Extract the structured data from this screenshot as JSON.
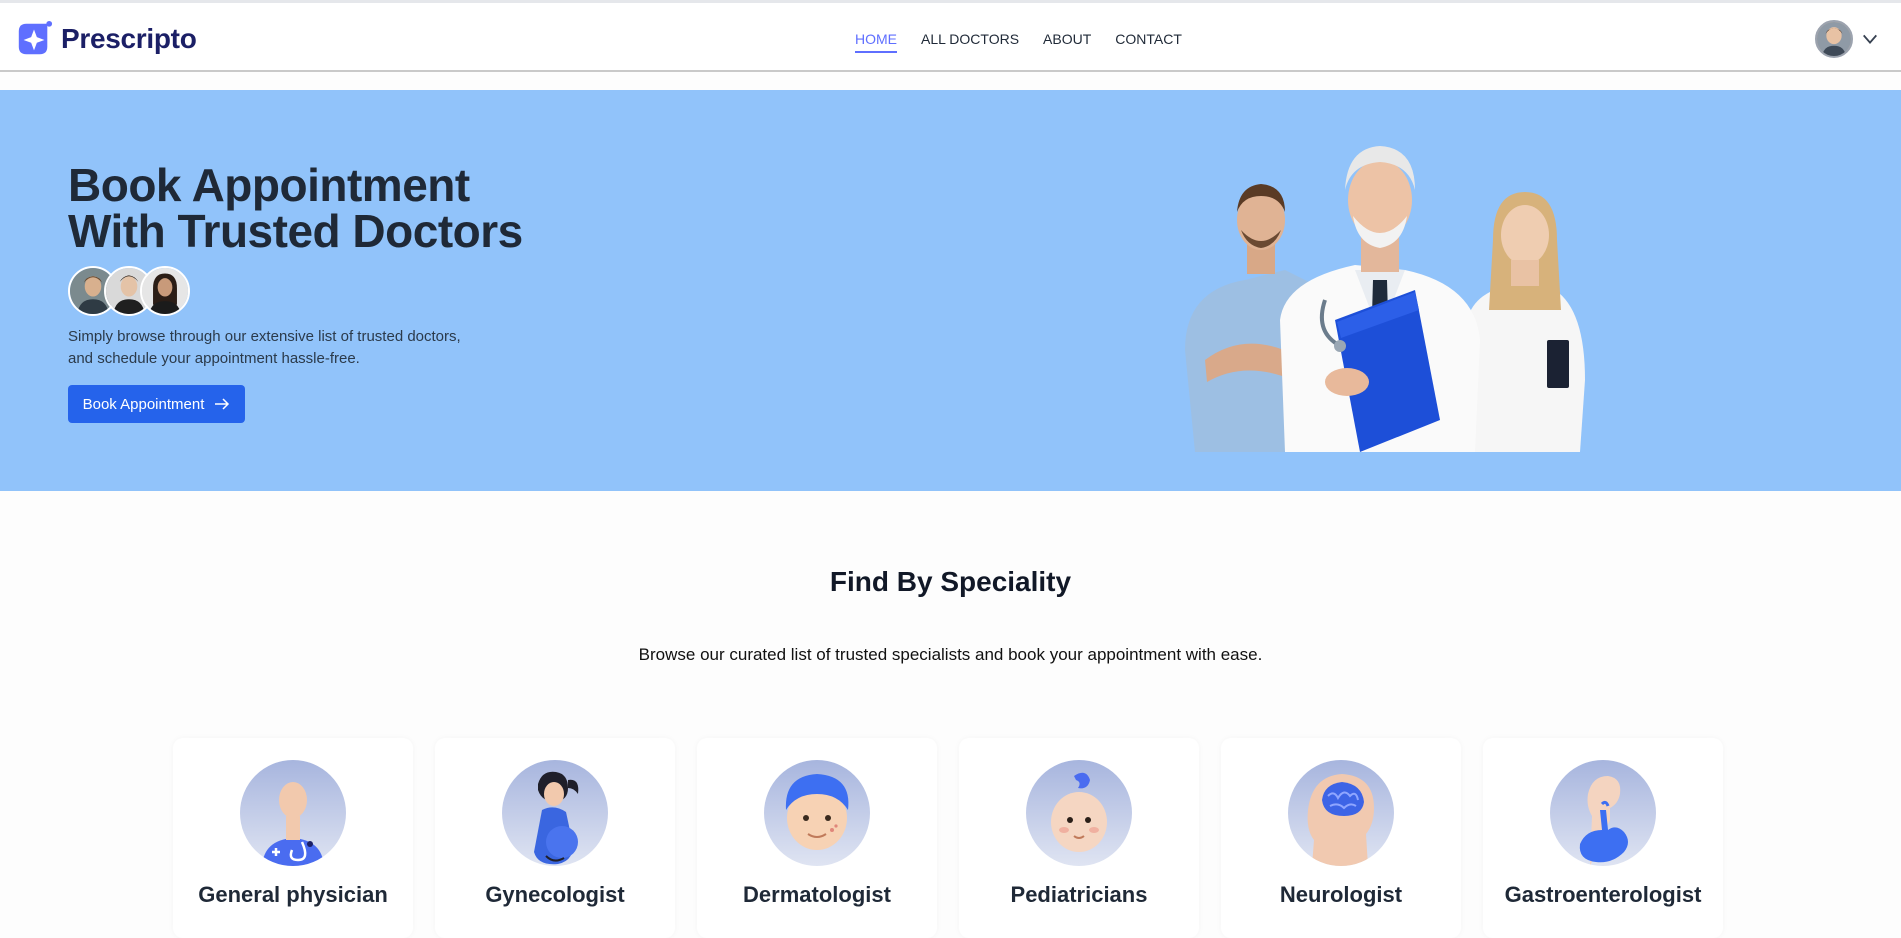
{
  "brand": {
    "name": "Prescripto",
    "accent": "#5f6fff"
  },
  "nav": {
    "items": [
      {
        "label": "HOME",
        "active": true
      },
      {
        "label": "ALL DOCTORS",
        "active": false
      },
      {
        "label": "ABOUT",
        "active": false
      },
      {
        "label": "CONTACT",
        "active": false
      }
    ]
  },
  "profile": {
    "avatar_icon": "user-avatar",
    "menu_icon": "chevron-down-icon"
  },
  "hero": {
    "title_line1": "Book Appointment",
    "title_line2": "With Trusted Doctors",
    "desc_line1": "Simply browse through our extensive list of trusted doctors,",
    "desc_line2": "and schedule your appointment hassle-free.",
    "button_label": "Book Appointment",
    "background": "#91c3fa"
  },
  "speciality": {
    "title": "Find By Speciality",
    "subtitle": "Browse our curated list of trusted specialists and book your appointment with ease.",
    "items": [
      {
        "label": "General physician",
        "icon": "general-physician-icon"
      },
      {
        "label": "Gynecologist",
        "icon": "gynecologist-icon"
      },
      {
        "label": "Dermatologist",
        "icon": "dermatologist-icon"
      },
      {
        "label": "Pediatricians",
        "icon": "pediatrician-icon"
      },
      {
        "label": "Neurologist",
        "icon": "neurologist-icon"
      },
      {
        "label": "Gastroenterologist",
        "icon": "gastroenterologist-icon"
      }
    ]
  }
}
